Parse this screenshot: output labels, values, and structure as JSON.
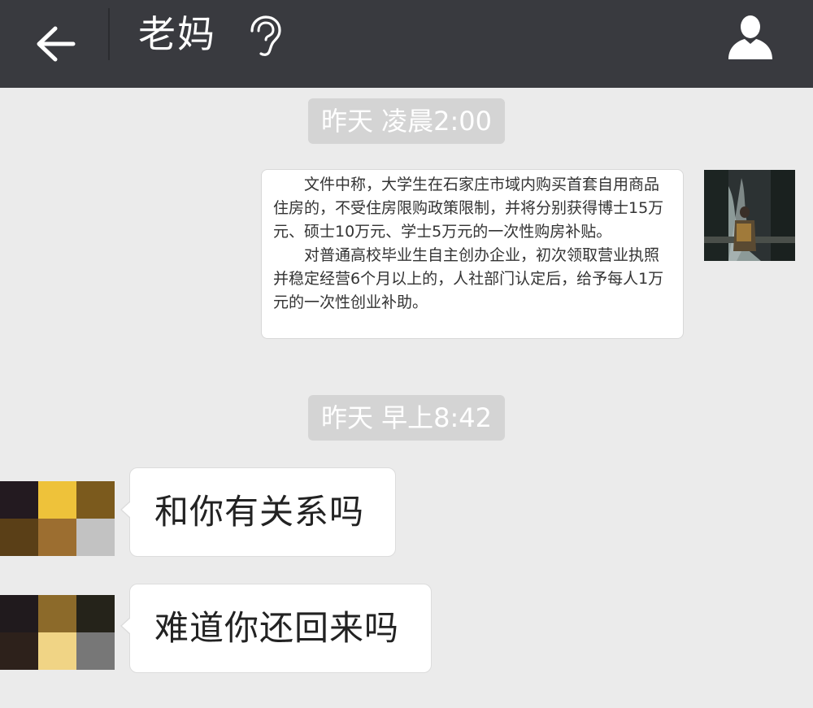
{
  "header": {
    "title": "老妈",
    "back_icon": "arrow-left-icon",
    "voice_mode_icon": "ear-icon",
    "profile_icon": "person-icon",
    "bg_color": "#393a3f"
  },
  "messages": [
    {
      "type": "timestamp",
      "text": "昨天 凌晨2:00"
    },
    {
      "type": "image",
      "sender": "me",
      "paragraphs": [
        "文件中称，大学生在石家庄市域内购买首套自用商品住房的，不受住房限购政策限制，并将分别获得博士15万元、硕士10万元、学士5万元的一次性购房补贴。",
        "对普通高校毕业生自主创办企业，初次领取营业执照并稳定经营6个月以上的，人社部门认定后，给予每人1万元的一次性创业补助。"
      ]
    },
    {
      "type": "timestamp",
      "text": "昨天 早上8:42"
    },
    {
      "type": "text",
      "sender": "mom",
      "text": "和你有关系吗"
    },
    {
      "type": "text",
      "sender": "mom",
      "text": "难道你还回来吗"
    }
  ],
  "colors": {
    "background": "#ebebeb",
    "timestamp_bg": "#d4d4d4",
    "bubble_bg": "#ffffff"
  },
  "avatar_pixels": {
    "row1": [
      "#231a20",
      "#eec23a",
      "#7b5a1d",
      "#5a3f17",
      "#9c6e30",
      "#c2c2c2"
    ],
    "row2": [
      "#201a1d",
      "#8c6a2a",
      "#25231a",
      "#2d211b",
      "#f0d485",
      "#777777"
    ]
  }
}
